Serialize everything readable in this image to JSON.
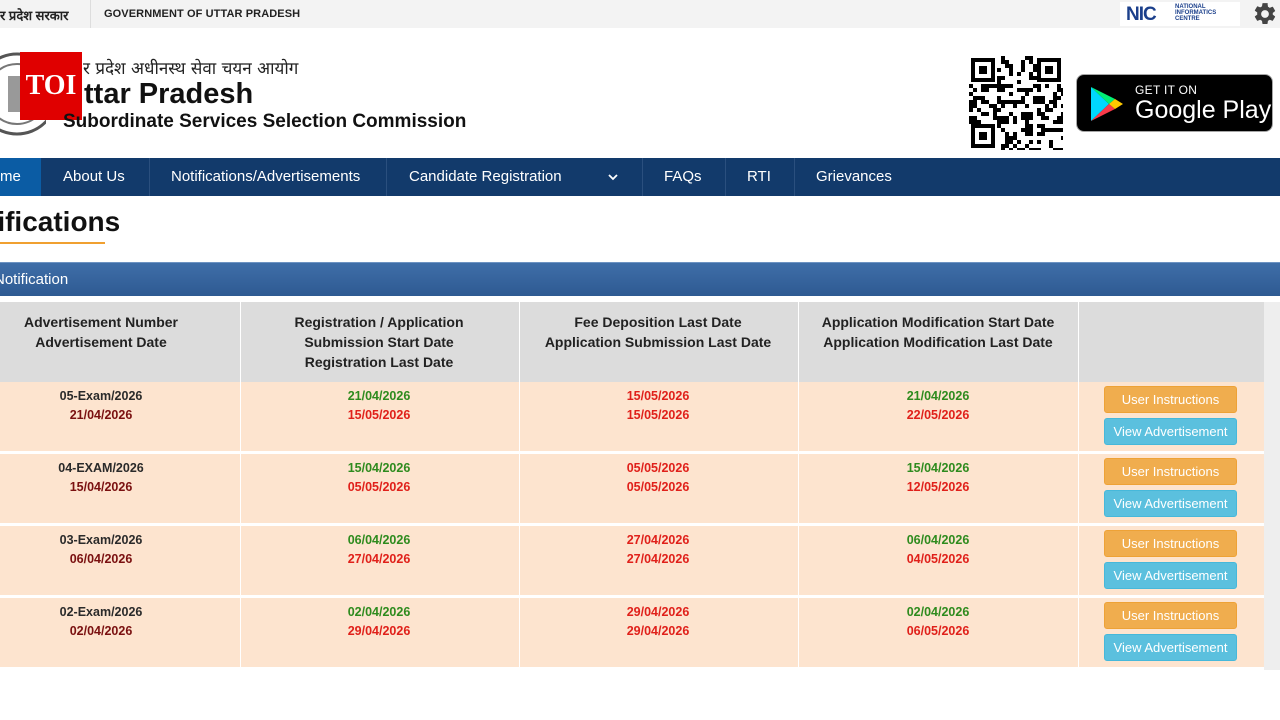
{
  "gov_bar": {
    "hindi_text": "र प्रदेश सरकार",
    "english_text": "GOVERNMENT OF UTTAR PRADESH",
    "nic_mark": "NIC",
    "nic_text": "NATIONAL INFORMATICS CENTRE",
    "settings_icon": "gear-icon"
  },
  "header": {
    "toi_badge": "TOI",
    "org_hindi": "र प्रदेश अधीनस्थ सेवा चयन आयोग",
    "org_name": "ttar Pradesh",
    "org_sub": "Subordinate Services Selection Commission",
    "play_small": "GET IT ON",
    "play_big": "Google Play"
  },
  "nav": {
    "items": [
      {
        "label": "me",
        "active": true
      },
      {
        "label": "About Us"
      },
      {
        "label": "Notifications/Advertisements"
      },
      {
        "label": "Candidate Registration"
      },
      {
        "label": "FAQs"
      },
      {
        "label": "RTI"
      },
      {
        "label": "Grievances"
      }
    ],
    "dropdown_icon": "chevron-down-icon"
  },
  "page_title": "tifications",
  "panel_title": "Notification",
  "table": {
    "headers": [
      [
        "Advertisement Number",
        "Advertisement Date"
      ],
      [
        "Registration / Application",
        "Submission  Start Date",
        "Registration Last Date"
      ],
      [
        "Fee Deposition Last Date",
        "Application Submission Last Date"
      ],
      [
        "Application Modification Start Date",
        "Application Modification Last Date"
      ]
    ],
    "rows": [
      {
        "adv_no": "05-Exam/2026",
        "adv_date": "21/04/2026",
        "reg_start": "21/04/2026",
        "reg_last": "15/05/2026",
        "fee_last": "15/05/2026",
        "sub_last": "15/05/2026",
        "mod_start": "21/04/2026",
        "mod_last": "22/05/2026"
      },
      {
        "adv_no": "04-EXAM/2026",
        "adv_date": "15/04/2026",
        "reg_start": "15/04/2026",
        "reg_last": "05/05/2026",
        "fee_last": "05/05/2026",
        "sub_last": "05/05/2026",
        "mod_start": "15/04/2026",
        "mod_last": "12/05/2026"
      },
      {
        "adv_no": "03-Exam/2026",
        "adv_date": "06/04/2026",
        "reg_start": "06/04/2026",
        "reg_last": "27/04/2026",
        "fee_last": "27/04/2026",
        "sub_last": "27/04/2026",
        "mod_start": "06/04/2026",
        "mod_last": "04/05/2026"
      },
      {
        "adv_no": "02-Exam/2026",
        "adv_date": "02/04/2026",
        "reg_start": "02/04/2026",
        "reg_last": "29/04/2026",
        "fee_last": "29/04/2026",
        "sub_last": "29/04/2026",
        "mod_start": "02/04/2026",
        "mod_last": "06/05/2026"
      }
    ],
    "btn_user_instructions": "User Instructions",
    "btn_view_advertisement": "View Advertisement"
  },
  "colors": {
    "nav_bg": "#123a6b",
    "row_bg": "#fde4cf",
    "start_date": "#2e8b1e",
    "last_date": "#e0201a",
    "btn_warning": "#f0ad4e",
    "btn_info": "#5bc0de"
  }
}
